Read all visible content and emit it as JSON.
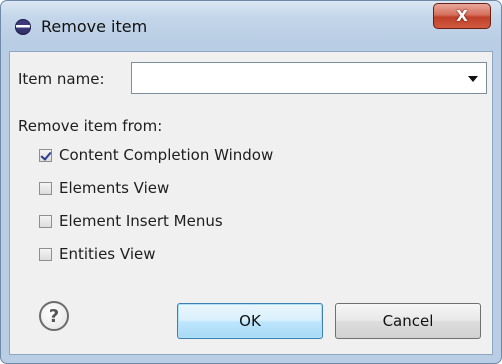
{
  "dialog": {
    "title": "Remove item",
    "close_label": "X"
  },
  "form": {
    "item_name_label": "Item name:",
    "item_name_value": "",
    "remove_from_label": "Remove item from:",
    "options": [
      {
        "label": "Content Completion Window",
        "checked": true
      },
      {
        "label": "Elements View",
        "checked": false
      },
      {
        "label": "Element Insert Menus",
        "checked": false
      },
      {
        "label": "Entities View",
        "checked": false
      }
    ]
  },
  "buttons": {
    "help_glyph": "?",
    "ok_label": "OK",
    "cancel_label": "Cancel"
  },
  "icons": [
    "app-icon",
    "close-icon",
    "dropdown-arrow-icon",
    "help-icon"
  ]
}
